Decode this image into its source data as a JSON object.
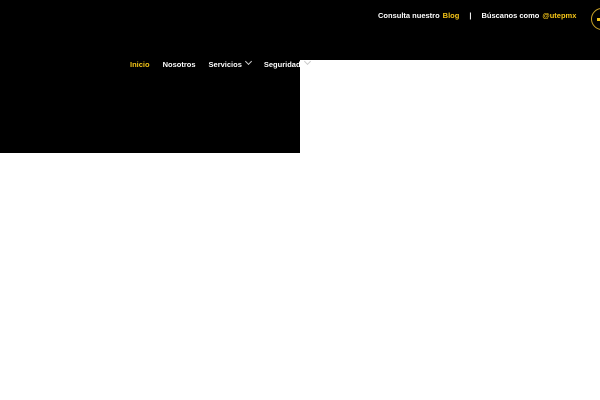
{
  "topbar": {
    "blog_prefix": "Consulta nuestro",
    "blog_link": "Blog",
    "separator": "|",
    "social_prefix": "Búscanos como",
    "social_handle": "@utepmx"
  },
  "nav": {
    "items": [
      {
        "label": "Inicio",
        "active": true,
        "has_dropdown": false
      },
      {
        "label": "Nosotros",
        "active": false,
        "has_dropdown": false
      },
      {
        "label": "Servicios",
        "active": false,
        "has_dropdown": true
      },
      {
        "label": "Seguridad",
        "active": false,
        "has_dropdown": true
      }
    ]
  },
  "icons": {
    "dropdown": "chevron-down-icon",
    "badge": "circle-logo-icon"
  },
  "colors": {
    "accent": "#f5c518",
    "background_dark": "#000000",
    "background_light": "#ffffff",
    "text": "#ffffff"
  }
}
